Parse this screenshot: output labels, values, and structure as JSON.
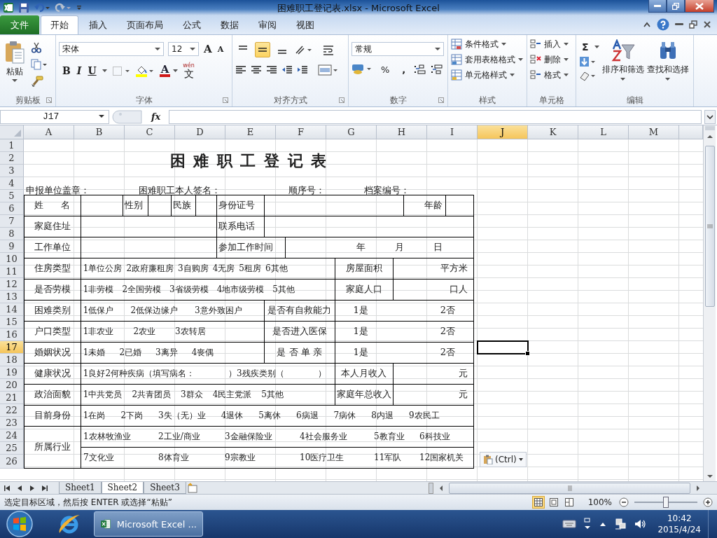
{
  "window": {
    "title": "困难职工登记表.xlsx - Microsoft Excel"
  },
  "ribbon_tabs": [
    {
      "label": "文件",
      "kind": "file",
      "selected": false
    },
    {
      "label": "开始",
      "kind": "tab",
      "selected": true
    },
    {
      "label": "插入",
      "kind": "tab",
      "selected": false
    },
    {
      "label": "页面布局",
      "kind": "tab",
      "selected": false
    },
    {
      "label": "公式",
      "kind": "tab",
      "selected": false
    },
    {
      "label": "数据",
      "kind": "tab",
      "selected": false
    },
    {
      "label": "审阅",
      "kind": "tab",
      "selected": false
    },
    {
      "label": "视图",
      "kind": "tab",
      "selected": false
    }
  ],
  "ribbon": {
    "clipboard": {
      "paste": "粘贴",
      "label": "剪贴板"
    },
    "font": {
      "name": "宋体",
      "size": "12",
      "grow": "A",
      "shrink": "A",
      "bold": "B",
      "italic": "I",
      "underline": "U",
      "color_letter": "A",
      "phonetic": "文",
      "phonetic_hint": "wén",
      "label": "字体"
    },
    "alignment": {
      "label": "对齐方式",
      "vertical": [
        {
          "selected": false
        },
        {
          "selected": true
        },
        {
          "selected": false
        }
      ]
    },
    "number": {
      "format": "常规",
      "percent": "%",
      "comma": ",",
      "label": "数字"
    },
    "styles": {
      "items": [
        "条件格式",
        "套用表格格式",
        "单元格样式"
      ],
      "label": "样式"
    },
    "cells": {
      "items": [
        "插入",
        "删除",
        "格式"
      ],
      "label": "单元格"
    },
    "editing": {
      "sum": "Σ",
      "sort": "排序和筛选",
      "find": "查找和选择",
      "label": "编辑"
    }
  },
  "formula_bar": {
    "name_box": "J17",
    "fx": "fx"
  },
  "sheet": {
    "columns": [
      {
        "label": "A",
        "selected": false
      },
      {
        "label": "B",
        "selected": false
      },
      {
        "label": "C",
        "selected": false
      },
      {
        "label": "D",
        "selected": false
      },
      {
        "label": "E",
        "selected": false
      },
      {
        "label": "F",
        "selected": false
      },
      {
        "label": "G",
        "selected": false
      },
      {
        "label": "H",
        "selected": false
      },
      {
        "label": "I",
        "selected": false
      },
      {
        "label": "J",
        "selected": true
      },
      {
        "label": "K",
        "selected": false
      },
      {
        "label": "L",
        "selected": false
      },
      {
        "label": "M",
        "selected": false
      }
    ],
    "rows": [
      {
        "label": "1",
        "selected": false
      },
      {
        "label": "2",
        "selected": false
      },
      {
        "label": "3",
        "selected": false
      },
      {
        "label": "4",
        "selected": false
      },
      {
        "label": "5",
        "selected": false
      },
      {
        "label": "6",
        "selected": false
      },
      {
        "label": "7",
        "selected": false
      },
      {
        "label": "8",
        "selected": false
      },
      {
        "label": "9",
        "selected": false
      },
      {
        "label": "10",
        "selected": false
      },
      {
        "label": "11",
        "selected": false
      },
      {
        "label": "12",
        "selected": false
      },
      {
        "label": "13",
        "selected": false
      },
      {
        "label": "14",
        "selected": false
      },
      {
        "label": "15",
        "selected": false
      },
      {
        "label": "16",
        "selected": false
      },
      {
        "label": "17",
        "selected": true
      },
      {
        "label": "18",
        "selected": false
      },
      {
        "label": "19",
        "selected": false
      },
      {
        "label": "20",
        "selected": false
      },
      {
        "label": "21",
        "selected": false
      },
      {
        "label": "22",
        "selected": false
      },
      {
        "label": "23",
        "selected": false
      },
      {
        "label": "24",
        "selected": false
      },
      {
        "label": "25",
        "selected": false
      },
      {
        "label": "26",
        "selected": false
      }
    ]
  },
  "form": {
    "title": "困 难 职 工 登 记 表",
    "header": [
      "申报单位盖章：",
      "困难职工本人签名：",
      "顺序号：",
      "档案编号："
    ],
    "rows": [
      {
        "kind": "identity",
        "label": "姓      名",
        "fields": [
          "性别",
          "民族",
          "身份证号",
          "年龄"
        ]
      },
      {
        "kind": "contact",
        "label": "家庭住址",
        "field": "联系电话"
      },
      {
        "kind": "work",
        "label": "工作单位",
        "field": "参加工作时间",
        "date_parts": [
          "年",
          "月",
          "日"
        ]
      },
      {
        "kind": "option_value",
        "label": "住房类型",
        "options": [
          "1单位公房",
          "2政府廉租房",
          "3自购房",
          "4无房",
          "5租房",
          "6其他"
        ],
        "field": "房屋面积",
        "unit": "平方米"
      },
      {
        "kind": "option_value",
        "label": "是否劳模",
        "options": [
          "1非劳模",
          "2全国劳模",
          "3省级劳模",
          "4地市级劳模",
          "5其他"
        ],
        "field": "家庭人口",
        "unit": "口人"
      },
      {
        "kind": "option_yesno",
        "label": "困难类别",
        "options": [
          "1低保户",
          "2低保边缘户",
          "3意外致困户"
        ],
        "field": "是否有自救能力",
        "choices": [
          "1是",
          "2否"
        ]
      },
      {
        "kind": "option_yesno",
        "label": "户口类型",
        "options": [
          "1非农业",
          "2农业",
          "3农转居"
        ],
        "field": "是否进入医保",
        "choices": [
          "1是",
          "2否"
        ]
      },
      {
        "kind": "option_yesno",
        "label": "婚姻状况",
        "options": [
          "1未婚",
          "2已婚",
          "3离异",
          "4丧偶"
        ],
        "field": "是 否 单 亲",
        "choices": [
          "1是",
          "2否"
        ]
      },
      {
        "kind": "option_value",
        "label": "健康状况",
        "options": [
          "1良好2何种疾病（填写病名：",
          "）3残疾类别（",
          "）"
        ],
        "field": "本人月收入",
        "unit": "元"
      },
      {
        "kind": "option_value",
        "label": "政治面貌",
        "options": [
          "1中共党员",
          "2共青团员",
          "3群众",
          "4民主党派",
          "5其他"
        ],
        "field": "家庭年总收入",
        "unit": "元"
      },
      {
        "kind": "option_wide",
        "label": "目前身份",
        "options": [
          "1在岗",
          "2下岗",
          "3失（无）业",
          "4退休",
          "5离休",
          "6病退",
          "7病休",
          "8内退",
          "9农民工"
        ]
      },
      {
        "kind": "industry",
        "label": "所属行业",
        "option_lines": [
          [
            "1农林牧渔业",
            "2工业/商业",
            "3金融保险业",
            "4社会服务业",
            "5教育业",
            "6科技业"
          ],
          [
            "7文化业",
            "8体育业",
            "9宗教业",
            "10医疗卫生",
            "11军队",
            "12国家机关"
          ]
        ]
      }
    ]
  },
  "paste_options": {
    "label": "(Ctrl)"
  },
  "sheet_tabs": [
    {
      "label": "Sheet1",
      "selected": false
    },
    {
      "label": "Sheet2",
      "selected": true
    },
    {
      "label": "Sheet3",
      "selected": false
    }
  ],
  "status_bar": {
    "message": "选定目标区域，然后按 ENTER 或选择“粘贴”",
    "views": [
      {
        "selected": true
      },
      {
        "selected": false
      },
      {
        "selected": false
      }
    ],
    "zoom": "100%",
    "zoom_slider": {
      "level": 0.5
    }
  },
  "taskbar": {
    "task": "Microsoft Excel ...",
    "time": "10:42",
    "date": "2015/4/24"
  }
}
